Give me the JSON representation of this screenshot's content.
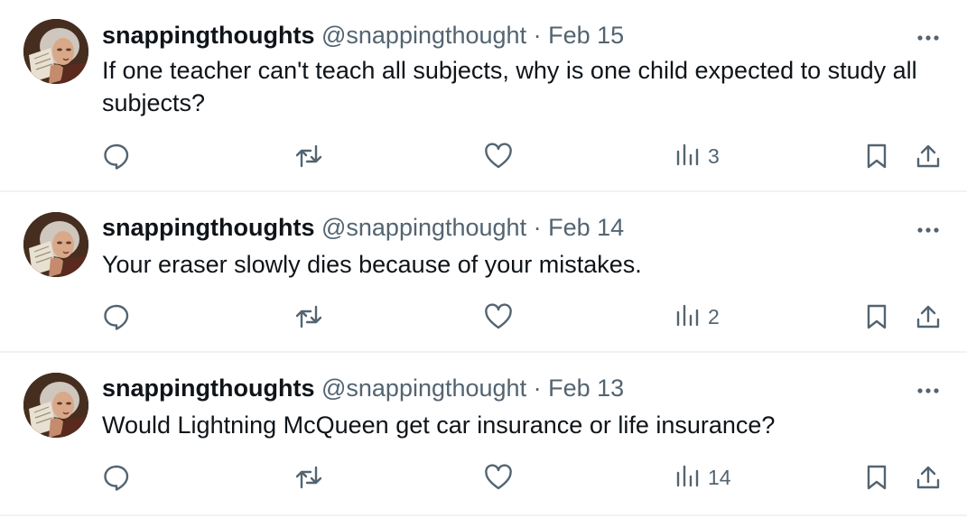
{
  "colors": {
    "text_primary": "#0f1419",
    "text_secondary": "#536471",
    "divider": "#eff3f4"
  },
  "icons": {
    "reply": "speech-bubble-icon",
    "retweet": "retweet-arrows-icon",
    "like": "heart-icon",
    "views": "bar-chart-icon",
    "bookmark": "bookmark-icon",
    "share": "share-upload-icon",
    "more": "horizontal-ellipsis-icon"
  },
  "tweets": [
    {
      "name": "snappingthoughts",
      "handle": "@snappingthought",
      "separator": "·",
      "date": "Feb 15",
      "text": "If one teacher can't teach all subjects, why is one child expected to study all subjects?",
      "views": "3"
    },
    {
      "name": "snappingthoughts",
      "handle": "@snappingthought",
      "separator": "·",
      "date": "Feb 14",
      "text": "Your eraser slowly dies because of your mistakes.",
      "views": "2"
    },
    {
      "name": "snappingthoughts",
      "handle": "@snappingthought",
      "separator": "·",
      "date": "Feb 13",
      "text": "Would Lightning McQueen get car insurance or life insurance?",
      "views": "14"
    }
  ]
}
